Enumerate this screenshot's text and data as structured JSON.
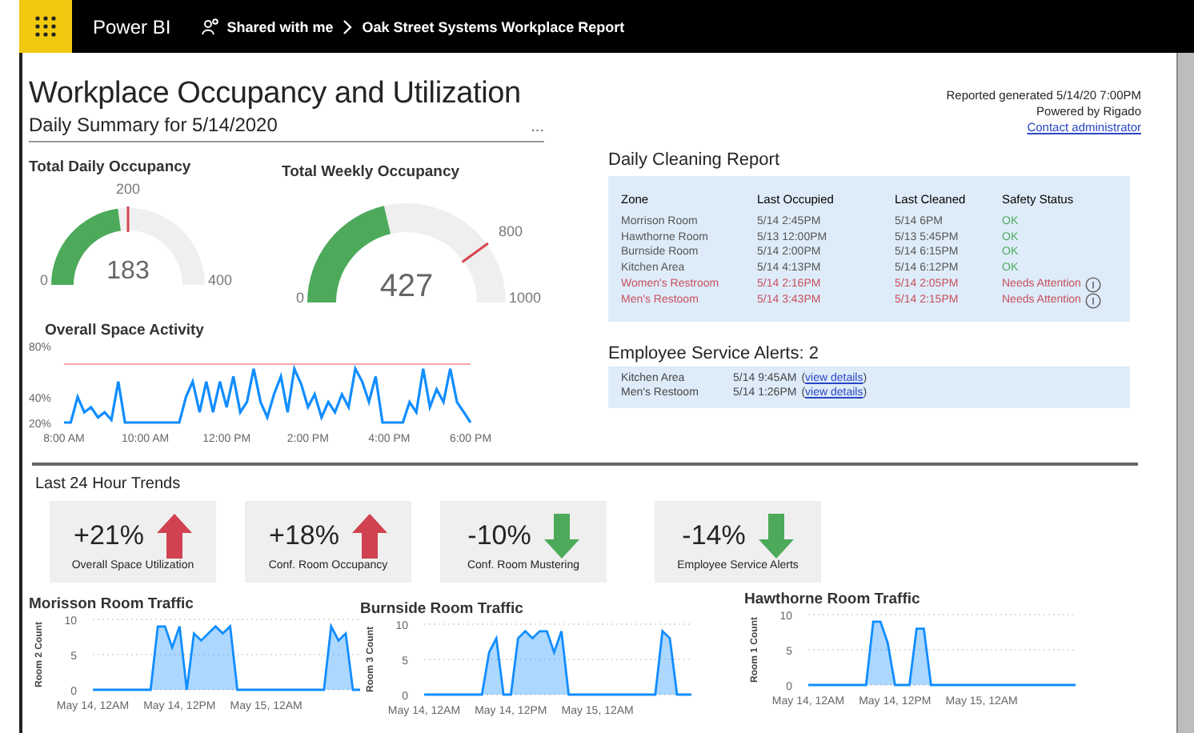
{
  "app_bar": {
    "product": "Power BI",
    "breadcrumb": [
      {
        "label": "Shared with me"
      },
      {
        "label": "Oak Street Systems Workplace Report"
      }
    ]
  },
  "header": {
    "title": "Workplace Occupancy and Utilization",
    "subtitle": "Daily Summary for 5/14/2020",
    "more": "...",
    "report_generated": "Reported generated 5/14/20 7:00PM",
    "powered_by": "Powered by Rigado",
    "contact_link": "Contact administrator"
  },
  "gauges": [
    {
      "title": "Total Daily Occupancy",
      "value": "183",
      "min": "0",
      "max": "400",
      "target": "200",
      "level": 0.4575
    },
    {
      "title": "Total Weekly Occupancy",
      "value": "427",
      "min": "0",
      "max": "1000",
      "target": "800",
      "level": 0.427
    }
  ],
  "activity": {
    "title": "Overall Space Activity",
    "chart_data": {
      "type": "line",
      "ylim": [
        20,
        80
      ],
      "yticks": [
        {
          "value": 20,
          "label": "20%"
        },
        {
          "value": 40,
          "label": "40%"
        },
        {
          "value": 80,
          "label": "80%"
        }
      ],
      "categories": [
        "8:00 AM",
        null,
        null,
        null,
        null,
        null,
        null,
        null,
        null,
        null,
        null,
        null,
        "10:00 AM",
        null,
        null,
        null,
        null,
        null,
        null,
        null,
        null,
        null,
        null,
        null,
        "12:00 PM",
        null,
        null,
        null,
        null,
        null,
        null,
        null,
        null,
        null,
        null,
        null,
        "2:00 PM",
        null,
        null,
        null,
        null,
        null,
        null,
        null,
        null,
        null,
        null,
        null,
        "4:00 PM",
        null,
        null,
        null,
        null,
        null,
        null,
        null,
        null,
        null,
        null,
        null,
        "6:00 PM"
      ],
      "series": [
        {
          "color": "#118dff",
          "values": [
            20,
            20,
            40,
            28,
            32,
            24,
            28,
            22,
            52,
            20,
            20,
            20,
            20,
            20,
            20,
            20,
            20,
            20,
            40,
            52,
            28,
            52,
            28,
            52,
            32,
            56,
            28,
            36,
            62,
            36,
            24,
            42,
            56,
            28,
            62,
            50,
            32,
            42,
            24,
            36,
            28,
            42,
            32,
            62,
            52,
            36,
            56,
            20,
            20,
            20,
            20,
            36,
            28,
            62,
            32,
            46,
            36,
            62,
            36,
            28,
            20
          ]
        }
      ]
    }
  },
  "cleaning_report": {
    "title": "Daily Cleaning Report",
    "columns": [
      "Zone",
      "Last Occupied",
      "Last Cleaned",
      "Safety Status"
    ],
    "rows": [
      {
        "cells": [
          "Morrison Room",
          "5/14 2:45PM",
          "5/14 6PM",
          "OK"
        ],
        "needs_attention": false
      },
      {
        "cells": [
          "Hawthorne Room",
          "5/13 12:00PM",
          "5/13 5:45PM",
          "OK"
        ],
        "needs_attention": false
      },
      {
        "cells": [
          "Burnside Room",
          "5/14 2:00PM",
          "5/14 6:15PM",
          "OK"
        ],
        "needs_attention": false
      },
      {
        "cells": [
          "Kitchen Area",
          "5/14 4:13PM",
          "5/14 6:12PM",
          "OK"
        ],
        "needs_attention": false
      },
      {
        "cells": [
          "Women's Restroom",
          "5/14 2:16PM",
          "5/14 2:05PM",
          "Needs Attention"
        ],
        "needs_attention": true
      },
      {
        "cells": [
          "Men's Restoom",
          "5/14 3:43PM",
          "5/14 2:15PM",
          "Needs Attention"
        ],
        "needs_attention": true
      }
    ]
  },
  "service_alerts": {
    "title": "Employee Service Alerts: 2",
    "rows": [
      {
        "zone": "Kitchen Area",
        "time": "5/14 9:45AM",
        "open": "(",
        "link": "view details",
        "close": ")"
      },
      {
        "zone": "Men's Restoom",
        "time": "5/14 1:26PM",
        "open": "(",
        "link": "view details",
        "close": ")"
      }
    ]
  },
  "trends": {
    "title": "Last 24 Hour Trends",
    "cards": [
      {
        "value": "+21%",
        "label": "Overall Space Utilization",
        "kind": "increase"
      },
      {
        "value": "+18%",
        "label": "Conf. Room Occupancy",
        "kind": "increase"
      },
      {
        "value": "-10%",
        "label": "Conf. Room Mustering",
        "kind": "decrease"
      },
      {
        "value": "-14%",
        "label": "Employee Service Alerts",
        "kind": "decrease"
      }
    ]
  },
  "traffic": [
    {
      "title": "Morisson Room Traffic",
      "chart_data": {
        "type": "area",
        "ylim": [
          0,
          10
        ],
        "yticks": [
          0,
          5,
          10
        ],
        "categories": [
          "May 14, 12AM",
          null,
          null,
          null,
          null,
          null,
          null,
          null,
          null,
          null,
          null,
          null,
          "May 14, 12PM",
          null,
          null,
          null,
          null,
          null,
          null,
          null,
          null,
          null,
          null,
          null,
          "May 15, 12AM",
          null,
          null,
          null,
          null,
          null,
          null,
          null,
          null,
          null,
          null,
          null,
          null,
          null
        ],
        "series": [
          {
            "name": "Room 2 Count",
            "color": "#118dff",
            "values": [
              0,
              0,
              0,
              0,
              0,
              0,
              0,
              0,
              0,
              9,
              9,
              6,
              9,
              0,
              8,
              7,
              8,
              9,
              8,
              9,
              0,
              0,
              0,
              0,
              0,
              0,
              0,
              0,
              0,
              0,
              0,
              0,
              0,
              9,
              7,
              8,
              0,
              0
            ]
          }
        ]
      }
    },
    {
      "title": "Burnside Room Traffic",
      "chart_data": {
        "type": "area",
        "ylim": [
          0,
          10
        ],
        "yticks": [
          0,
          5,
          10
        ],
        "categories": [
          "May 14, 12AM",
          null,
          null,
          null,
          null,
          null,
          null,
          null,
          null,
          null,
          null,
          null,
          "May 14, 12PM",
          null,
          null,
          null,
          null,
          null,
          null,
          null,
          null,
          null,
          null,
          null,
          "May 15, 12AM",
          null,
          null,
          null,
          null,
          null,
          null,
          null,
          null,
          null,
          null,
          null,
          null,
          null
        ],
        "series": [
          {
            "name": "Room 3 Count",
            "color": "#118dff",
            "values": [
              0,
              0,
              0,
              0,
              0,
              0,
              0,
              0,
              0,
              6,
              8,
              0,
              0,
              8,
              9,
              8,
              9,
              9,
              6,
              9,
              0,
              0,
              0,
              0,
              0,
              0,
              0,
              0,
              0,
              0,
              0,
              0,
              0,
              9,
              8,
              0,
              0,
              0
            ]
          }
        ]
      }
    },
    {
      "title": "Hawthorne Room Traffic",
      "chart_data": {
        "type": "area",
        "ylim": [
          0,
          10
        ],
        "yticks": [
          0,
          5,
          10
        ],
        "categories": [
          "May 14, 12AM",
          null,
          null,
          null,
          null,
          null,
          null,
          null,
          null,
          null,
          null,
          null,
          "May 14, 12PM",
          null,
          null,
          null,
          null,
          null,
          null,
          null,
          null,
          null,
          null,
          null,
          "May 15, 12AM",
          null,
          null,
          null,
          null,
          null,
          null,
          null,
          null,
          null,
          null,
          null,
          null,
          null
        ],
        "series": [
          {
            "name": "Room 1 Count",
            "color": "#118dff",
            "values": [
              0,
              0,
              0,
              0,
              0,
              0,
              0,
              0,
              0,
              9,
              9,
              6,
              0,
              0,
              0,
              8,
              8,
              0,
              0,
              0,
              0,
              0,
              0,
              0,
              0,
              0,
              0,
              0,
              0,
              0,
              0,
              0,
              0,
              0,
              0,
              0,
              0,
              0
            ]
          }
        ]
      }
    }
  ]
}
